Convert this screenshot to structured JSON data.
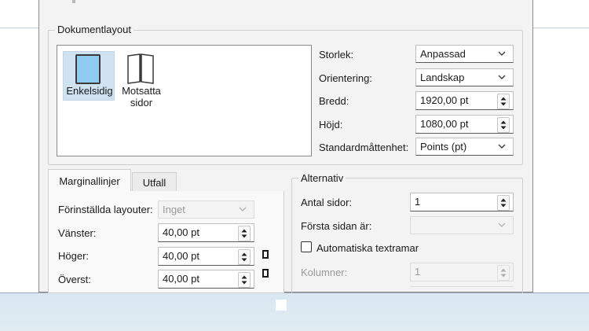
{
  "dialog": {
    "layout_group": {
      "label": "Dokumentlayout",
      "options": [
        {
          "label": "Enkelsidig",
          "selected": true
        },
        {
          "label": "Motsatta\nsidor",
          "selected": false
        }
      ],
      "fields": {
        "size": {
          "label": "Storlek:",
          "value": "Anpassad"
        },
        "orientation": {
          "label": "Orientering:",
          "value": "Landskap"
        },
        "width": {
          "label": "Bredd:",
          "value": "1920,00 pt"
        },
        "height": {
          "label": "Höjd:",
          "value": "1080,00 pt"
        },
        "unit": {
          "label": "Standardmåttenhet:",
          "value": "Points (pt)"
        }
      }
    },
    "tabs": [
      {
        "label": "Marginallinjer",
        "active": true
      },
      {
        "label": "Utfall",
        "active": false
      }
    ],
    "margins": {
      "preset": {
        "label": "Förinställda layouter:",
        "value": "Inget"
      },
      "left": {
        "label": "Vänster:",
        "value": "40,00 pt"
      },
      "right": {
        "label": "Höger:",
        "value": "40,00 pt"
      },
      "top": {
        "label": "Överst:",
        "value": "40,00 pt"
      }
    },
    "options_group": {
      "label": "Alternativ",
      "page_count": {
        "label": "Antal sidor:",
        "value": "1"
      },
      "first_page": {
        "label": "Första sidan är:",
        "value": ""
      },
      "auto_frames": {
        "label": "Automatiska textramar",
        "checked": false
      },
      "columns": {
        "label": "Kolumner:",
        "value": "1"
      }
    }
  }
}
